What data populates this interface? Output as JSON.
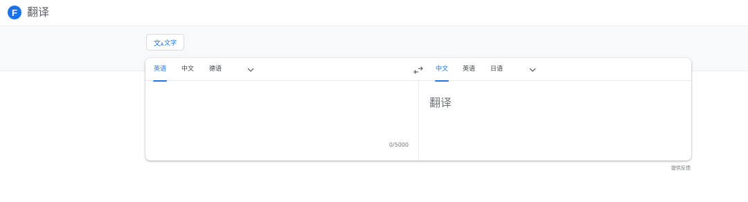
{
  "header": {
    "logo_letter": "F",
    "app_title": "翻译"
  },
  "mode": {
    "icon_text_big": "文",
    "icon_text_small": "A",
    "label": "文字"
  },
  "source_langs": {
    "tabs": [
      "英语",
      "中文",
      "德语"
    ],
    "active_index": 0
  },
  "target_langs": {
    "tabs": [
      "中文",
      "英语",
      "日语"
    ],
    "active_index": 0
  },
  "source": {
    "value": "",
    "char_count": "0/5000"
  },
  "target": {
    "placeholder": "翻译"
  },
  "feedback_label": "提供反馈",
  "colors": {
    "accent": "#1a73e8",
    "band": "#f8f9fa",
    "text": "#3c4043",
    "muted": "#70757a"
  }
}
